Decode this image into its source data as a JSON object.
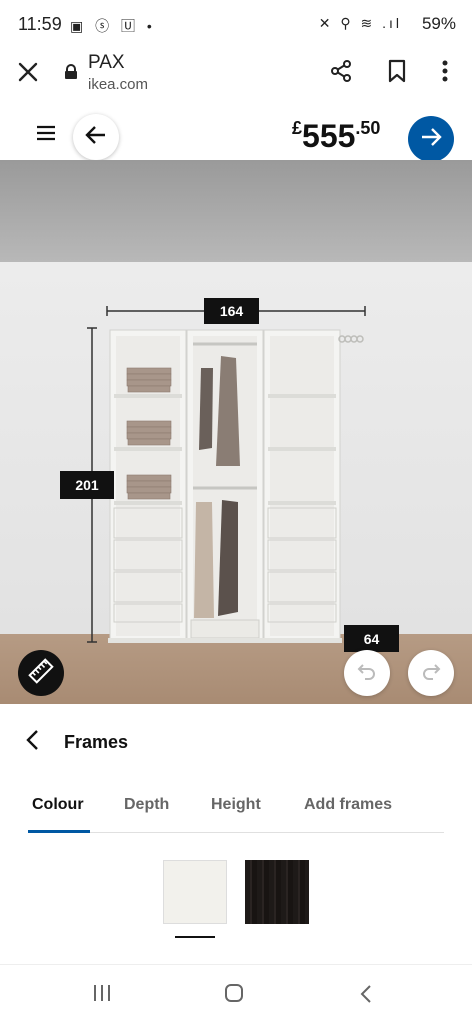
{
  "status_bar": {
    "time": "11:59",
    "left_icons": "▣ ⓢ 🅄 •",
    "right_icons": "✕ ⚲ ≋ .ıl",
    "battery": "59%"
  },
  "browser": {
    "site_title": "PAX",
    "site_url": "ikea.com"
  },
  "header": {
    "price_currency": "£",
    "price_main": "555",
    "price_decimal": ".50"
  },
  "planner": {
    "width_label": "164",
    "height_label": "201",
    "depth_label": "64"
  },
  "panel": {
    "title": "Frames",
    "tabs": [
      {
        "label": "Colour",
        "active": true
      },
      {
        "label": "Depth"
      },
      {
        "label": "Height"
      },
      {
        "label": "Add frames"
      }
    ],
    "swatches": [
      {
        "name": "white",
        "color": "#f2f1ec",
        "selected": true
      },
      {
        "name": "black-brown",
        "color": "#1e1a18"
      }
    ]
  },
  "colors": {
    "accent": "#0058a3",
    "label_bg": "#111111"
  },
  "icons": [
    "close-icon",
    "lock-icon",
    "share-icon",
    "bookmark-icon",
    "more-icon",
    "menu-icon",
    "arrow-left-icon",
    "arrow-right-icon",
    "ruler-icon",
    "undo-icon",
    "redo-icon",
    "chevron-left-icon"
  ]
}
